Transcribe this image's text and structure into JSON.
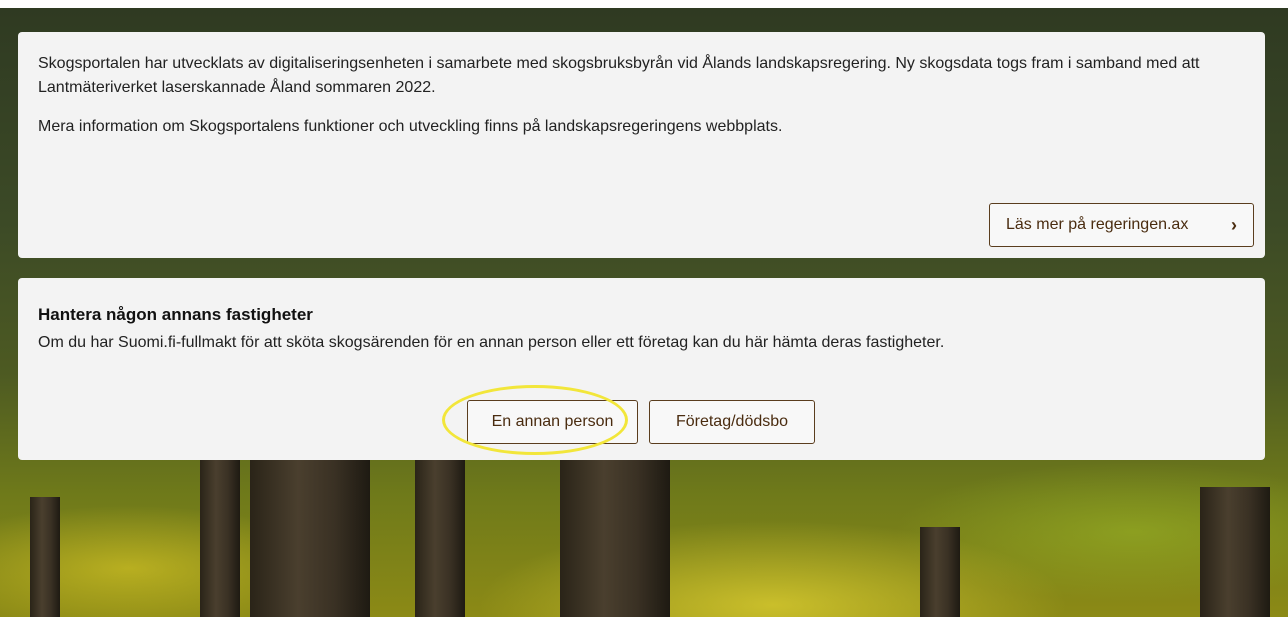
{
  "info_card": {
    "paragraph_1": "Skogsportalen har utvecklats av digitaliseringsenheten i samarbete med skogsbruksbyrån vid Ålands landskapsregering. Ny skogsdata togs fram i samband med att Lantmäteriverket laserskannade Åland sommaren 2022.",
    "paragraph_2": "Mera information om Skogsportalens funktioner och utveckling finns på landskapsregeringens webbplats.",
    "read_more_button": "Läs mer på regeringen.ax",
    "read_more_icon": "chevron-right-icon"
  },
  "manage_card": {
    "heading": "Hantera någon annans fastigheter",
    "description": "Om du har Suomi.fi-fullmakt för att sköta skogsärenden för en annan person eller ett företag kan du här hämta deras fastigheter.",
    "person_button": "En annan person",
    "company_button": "Företag/dödsbo"
  },
  "colors": {
    "card_background": "#f3f3f3",
    "button_text": "#4a2c10",
    "button_border": "#5a3d1e",
    "highlight_ring": "#f2e63a"
  }
}
